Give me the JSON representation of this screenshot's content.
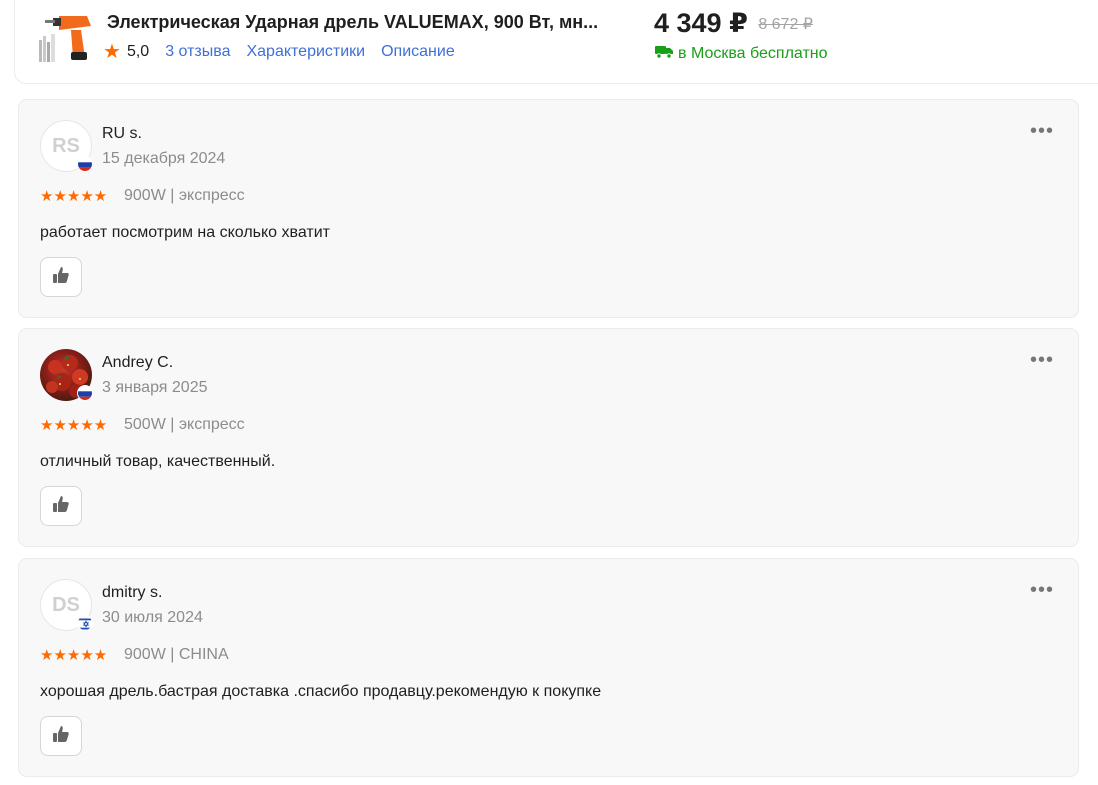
{
  "product": {
    "title": "Электрическая Ударная дрель VALUEMAX, 900 Вт, мн...",
    "rating": "5,0",
    "reviews_link": "3 отзыва",
    "specs_link": "Характеристики",
    "description_link": "Описание",
    "price": "4 349 ₽",
    "old_price": "8 672 ₽",
    "delivery": "в Москва бесплатно"
  },
  "reviews": [
    {
      "initials": "RS",
      "author": "RU s.",
      "date": "15 декабря 2024",
      "stars": "★★★★★",
      "variant": "900W | экспресс",
      "text": "работает посмотрим на сколько хватит",
      "flag": "ru"
    },
    {
      "initials": "",
      "author": "Andrey C.",
      "date": "3 января 2025",
      "stars": "★★★★★",
      "variant": "500W | экспресс",
      "text": "отличный товар, качественный.",
      "flag": "ru"
    },
    {
      "initials": "DS",
      "author": "dmitry s.",
      "date": "30 июля 2024",
      "stars": "★★★★★",
      "variant": "900W | CHINA",
      "text": "хорошая дрель.бастрая доставка .спасибо продавцу.рекомендую к покупке",
      "flag": "il"
    }
  ],
  "icons": {
    "star": "star-icon",
    "truck": "truck-icon",
    "thumb": "thumbs-up-icon",
    "more": "more-icon"
  },
  "colors": {
    "accent": "#ff6a00",
    "link": "#3f6fd8",
    "delivery": "#19a019"
  }
}
